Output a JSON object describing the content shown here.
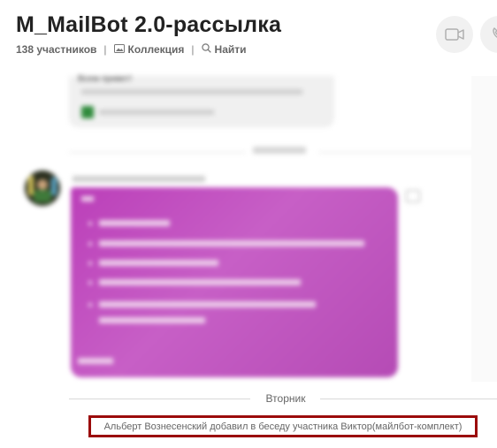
{
  "header": {
    "title": "M_MailBot 2.0-рассылка",
    "participants": "138 участников",
    "separator": "|",
    "collection_label": "Коллекция",
    "find_label": "Найти",
    "collection_icon": "gallery-icon",
    "find_icon": "search-icon",
    "video_call_icon": "video-camera-icon",
    "audio_call_icon": "phone-icon"
  },
  "history": {
    "blurred": true,
    "greeting": "Всем привет!"
  },
  "timeline": {
    "day_label": "Вторник",
    "event_text": "Альберт Вознесенский добавил в беседу участника Виктор(майлбот-комплект)"
  },
  "colors": {
    "highlight_border": "#9b0b0b",
    "bubble_pink": "#bb3fb9"
  }
}
